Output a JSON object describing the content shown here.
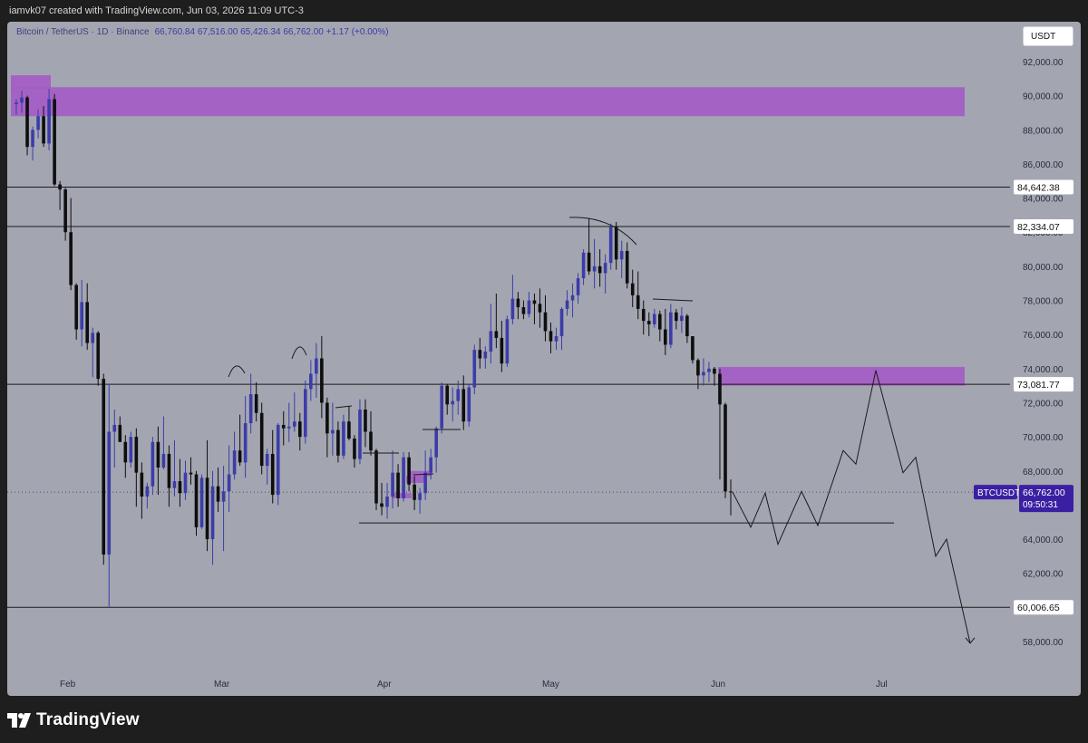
{
  "header": {
    "caption": "iamvk07 created with TradingView.com, Jun 03, 2026 11:09 UTC-3"
  },
  "symbol": {
    "name": "Bitcoin / TetherUS · 1D · Binance",
    "values": "66,760.84  67,516.00  65,426.34  66,762.00  +1.17 (+0.00%)"
  },
  "currency_button": "USDT",
  "footer": {
    "brand": "TradingView"
  },
  "colors": {
    "background": "#a3a6b1",
    "bull_candle": "#3c3ca8",
    "bear_candle": "#0e0e0e",
    "zone": "#a45bc7",
    "price_label_bg": "#3b1fa3"
  },
  "chart_data": {
    "type": "candlestick",
    "symbol": "BTCUSDT",
    "interval": "1D",
    "ylim": [
      57000,
      94000
    ],
    "y_ticks": [
      "58,000.00",
      "60,000.00",
      "62,000.00",
      "64,000.00",
      "66,000.00",
      "68,000.00",
      "70,000.00",
      "72,000.00",
      "74,000.00",
      "76,000.00",
      "78,000.00",
      "80,000.00",
      "82,000.00",
      "84,000.00",
      "86,000.00",
      "88,000.00",
      "90,000.00",
      "92,000.00"
    ],
    "x_ticks": [
      "Feb",
      "Mar",
      "Apr",
      "May",
      "Jun",
      "Jul"
    ],
    "current_price": {
      "label": "BTCUSDT",
      "value": "66,762.00",
      "countdown": "09:50:31"
    },
    "horizontal_levels": [
      {
        "label": "84,642.38",
        "value": 84642.38
      },
      {
        "label": "82,334.07",
        "value": 82334.07
      },
      {
        "label": "73,081.77",
        "value": 73081.77
      },
      {
        "label": "60,006.65",
        "value": 60006.65
      }
    ],
    "candles": [
      [
        89500,
        89800,
        88900,
        89600
      ],
      [
        89600,
        90300,
        89000,
        89900
      ],
      [
        89900,
        90000,
        86500,
        87000
      ],
      [
        87000,
        88200,
        86200,
        88000
      ],
      [
        88000,
        89200,
        87500,
        88800
      ],
      [
        88800,
        89400,
        87000,
        87200
      ],
      [
        87200,
        90400,
        86800,
        89800
      ],
      [
        89800,
        90100,
        84700,
        84800
      ],
      [
        84800,
        85000,
        83300,
        84500
      ],
      [
        84500,
        84600,
        81500,
        82000
      ],
      [
        82000,
        84000,
        78600,
        78900
      ],
      [
        78900,
        79000,
        75700,
        76300
      ],
      [
        76300,
        79200,
        75300,
        77900
      ],
      [
        77900,
        79000,
        75100,
        75500
      ],
      [
        75500,
        76400,
        73500,
        76100
      ],
      [
        76100,
        76200,
        73000,
        73400
      ],
      [
        73400,
        73700,
        62500,
        63100
      ],
      [
        63100,
        73100,
        60000,
        70300
      ],
      [
        70300,
        71600,
        68200,
        70700
      ],
      [
        70700,
        71200,
        69700,
        69700
      ],
      [
        69700,
        70100,
        67600,
        68500
      ],
      [
        68500,
        70300,
        68200,
        70000
      ],
      [
        70000,
        70500,
        65900,
        67900
      ],
      [
        67900,
        68500,
        65200,
        66500
      ],
      [
        66500,
        67300,
        65800,
        67100
      ],
      [
        67100,
        70000,
        66600,
        69700
      ],
      [
        69700,
        70600,
        66600,
        68200
      ],
      [
        68200,
        71200,
        68100,
        69000
      ],
      [
        69000,
        69500,
        65900,
        67000
      ],
      [
        67000,
        69800,
        66500,
        67400
      ],
      [
        67400,
        68700,
        65900,
        66700
      ],
      [
        66700,
        68600,
        66300,
        67900
      ],
      [
        67900,
        68800,
        67200,
        67800
      ],
      [
        67800,
        68000,
        64200,
        64700
      ],
      [
        64700,
        67800,
        64600,
        67600
      ],
      [
        67600,
        69800,
        63300,
        64000
      ],
      [
        64000,
        68000,
        62500,
        67100
      ],
      [
        67100,
        68200,
        65600,
        66200
      ],
      [
        66200,
        68300,
        63300,
        66800
      ],
      [
        66800,
        69500,
        65600,
        67800
      ],
      [
        67800,
        70300,
        67500,
        69200
      ],
      [
        69200,
        71300,
        68300,
        68500
      ],
      [
        68500,
        72400,
        67600,
        70800
      ],
      [
        70800,
        73700,
        70200,
        72500
      ],
      [
        72500,
        73200,
        70900,
        71400
      ],
      [
        71400,
        72000,
        67800,
        68300
      ],
      [
        68300,
        69300,
        67200,
        69000
      ],
      [
        69000,
        70400,
        66100,
        66600
      ],
      [
        66600,
        70800,
        66000,
        70700
      ],
      [
        70700,
        71500,
        69500,
        70500
      ],
      [
        70500,
        72000,
        69700,
        70600
      ],
      [
        70600,
        72600,
        70300,
        70900
      ],
      [
        70900,
        71400,
        69200,
        70000
      ],
      [
        70000,
        73300,
        69600,
        72800
      ],
      [
        72800,
        74500,
        72100,
        73700
      ],
      [
        73700,
        75500,
        72300,
        74600
      ],
      [
        74600,
        75900,
        71100,
        72000
      ],
      [
        72000,
        72300,
        68800,
        70200
      ],
      [
        70200,
        72000,
        68900,
        70400
      ],
      [
        70400,
        70900,
        68500,
        68900
      ],
      [
        68900,
        71300,
        68700,
        70900
      ],
      [
        70900,
        71800,
        69800,
        69900
      ],
      [
        69900,
        70100,
        68200,
        68700
      ],
      [
        68700,
        72200,
        68400,
        71600
      ],
      [
        71600,
        72200,
        69400,
        70300
      ],
      [
        70300,
        71500,
        68900,
        69200
      ],
      [
        69200,
        69300,
        65700,
        66100
      ],
      [
        66100,
        67300,
        65400,
        65900
      ],
      [
        65900,
        67300,
        65200,
        66500
      ],
      [
        66500,
        69200,
        65800,
        67900
      ],
      [
        67900,
        68400,
        65900,
        66400
      ],
      [
        66400,
        69100,
        66200,
        68800
      ],
      [
        68800,
        69100,
        66800,
        67200
      ],
      [
        67200,
        67700,
        65700,
        66300
      ],
      [
        66300,
        67000,
        65500,
        66700
      ],
      [
        66700,
        69200,
        66300,
        67900
      ],
      [
        67900,
        69300,
        67500,
        68800
      ],
      [
        68800,
        70600,
        67900,
        70500
      ],
      [
        70500,
        73200,
        70200,
        73000
      ],
      [
        73000,
        73100,
        71300,
        71900
      ],
      [
        71900,
        72900,
        70900,
        72100
      ],
      [
        72100,
        73300,
        71300,
        72800
      ],
      [
        72800,
        73600,
        70400,
        70900
      ],
      [
        70900,
        73100,
        70600,
        72900
      ],
      [
        72900,
        75400,
        72500,
        75100
      ],
      [
        75100,
        75800,
        74000,
        74600
      ],
      [
        74600,
        75300,
        74000,
        75000
      ],
      [
        75000,
        77800,
        74300,
        76200
      ],
      [
        76200,
        78400,
        75200,
        75800
      ],
      [
        75800,
        76800,
        73800,
        74300
      ],
      [
        74300,
        77100,
        74100,
        76900
      ],
      [
        76900,
        79500,
        76600,
        78100
      ],
      [
        78100,
        78500,
        76900,
        77600
      ],
      [
        77600,
        78000,
        76900,
        77200
      ],
      [
        77200,
        78500,
        77000,
        78000
      ],
      [
        78000,
        78400,
        76600,
        77800
      ],
      [
        77800,
        78700,
        76400,
        77300
      ],
      [
        77300,
        78300,
        75600,
        76200
      ],
      [
        76200,
        76700,
        74900,
        75600
      ],
      [
        75600,
        76400,
        75100,
        75900
      ],
      [
        75900,
        77600,
        75100,
        77500
      ],
      [
        77500,
        78600,
        77100,
        78000
      ],
      [
        78000,
        79000,
        77000,
        78300
      ],
      [
        78300,
        79600,
        77800,
        79300
      ],
      [
        79300,
        81000,
        78900,
        80800
      ],
      [
        80800,
        82800,
        79500,
        79700
      ],
      [
        79700,
        81600,
        78700,
        80000
      ],
      [
        80000,
        81000,
        78800,
        79600
      ],
      [
        79600,
        80700,
        78400,
        80200
      ],
      [
        80200,
        82500,
        79800,
        82300
      ],
      [
        82300,
        82600,
        79800,
        80400
      ],
      [
        80400,
        81500,
        79300,
        80900
      ],
      [
        80900,
        81400,
        78700,
        79000
      ],
      [
        79000,
        79800,
        77600,
        78300
      ],
      [
        78300,
        79700,
        76900,
        77500
      ],
      [
        77500,
        78000,
        76000,
        76800
      ],
      [
        76800,
        77300,
        75900,
        76600
      ],
      [
        76600,
        77500,
        76400,
        77200
      ],
      [
        77200,
        77400,
        75600,
        76300
      ],
      [
        76300,
        77500,
        74800,
        75400
      ],
      [
        75400,
        77800,
        75200,
        77300
      ],
      [
        77300,
        77500,
        76300,
        76800
      ],
      [
        76800,
        77600,
        76100,
        77100
      ],
      [
        77100,
        77200,
        75500,
        75900
      ],
      [
        75900,
        75900,
        74300,
        74500
      ],
      [
        74500,
        74600,
        72800,
        73600
      ],
      [
        73600,
        74600,
        73000,
        73800
      ],
      [
        73800,
        74400,
        73200,
        74000
      ],
      [
        74000,
        74100,
        73000,
        73700
      ],
      [
        73700,
        74000,
        67500,
        71900
      ],
      [
        71900,
        72000,
        66400,
        66800
      ],
      [
        66800,
        67500,
        65400,
        66762
      ]
    ],
    "zones": [
      {
        "from": 88800,
        "to": 90500
      },
      {
        "from": 90400,
        "to": 91200
      },
      {
        "from": 73000,
        "to": 74100
      },
      {
        "from": 67700,
        "to": 68000
      },
      {
        "from": 67300,
        "to": 67700
      },
      {
        "from": 66400,
        "to": 66700
      }
    ],
    "projection": [
      66762,
      64700,
      66700,
      63700,
      66800,
      64800,
      69200,
      68400,
      73900,
      67900,
      68800,
      63000,
      64000,
      57900
    ]
  }
}
